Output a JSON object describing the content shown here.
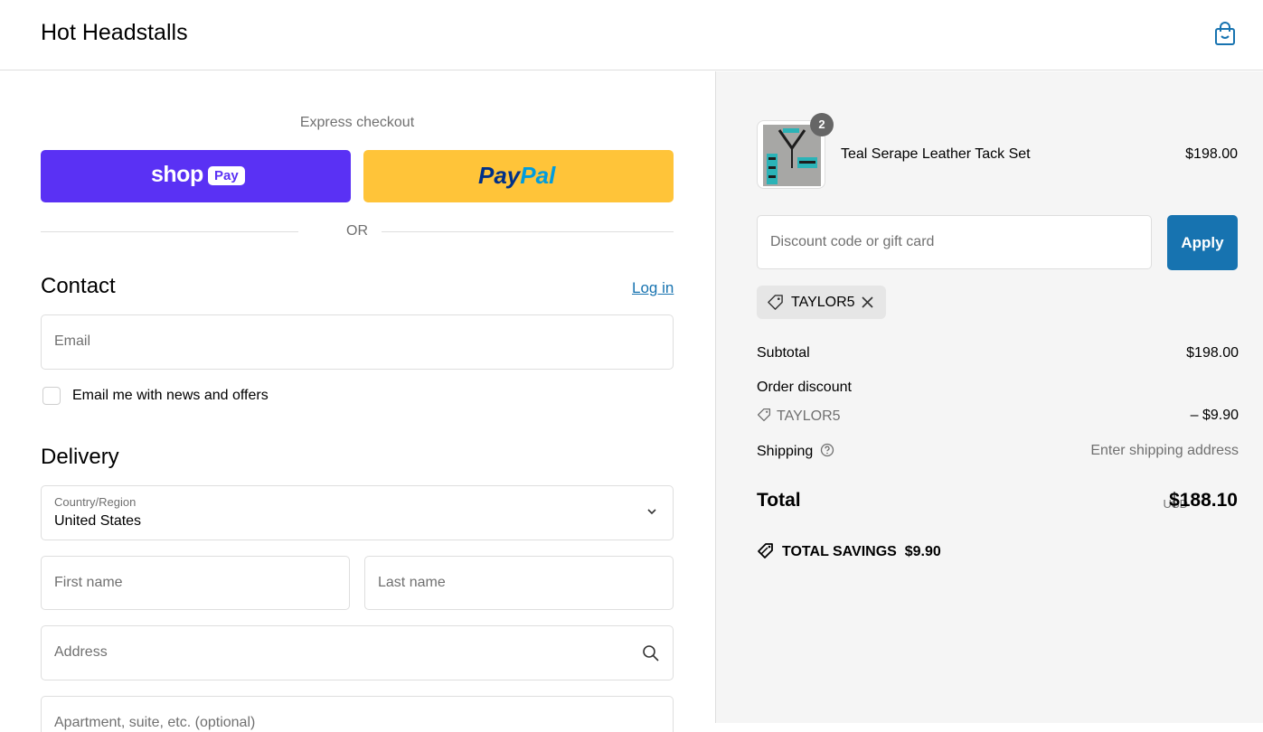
{
  "header": {
    "store_name": "Hot Headstalls",
    "cart_icon": "shopping-bag-icon"
  },
  "express": {
    "title": "Express checkout",
    "shop_pay_word": "shop",
    "shop_pay_badge": "Pay",
    "paypal_a": "Pay",
    "paypal_b": "Pal",
    "or_text": "OR"
  },
  "contact": {
    "heading": "Contact",
    "login_link": "Log in",
    "email_placeholder": "Email",
    "newsletter_label": "Email me with news and offers",
    "newsletter_checked": false
  },
  "delivery": {
    "heading": "Delivery",
    "country_label": "Country/Region",
    "country_value": "United States",
    "first_name_placeholder": "First name",
    "last_name_placeholder": "Last name",
    "address_placeholder": "Address",
    "apartment_placeholder": "Apartment, suite, etc. (optional)"
  },
  "order": {
    "item": {
      "name": "Teal Serape Leather Tack Set",
      "price": "$198.00",
      "quantity": "2"
    },
    "discount_placeholder": "Discount code or gift card",
    "apply_label": "Apply",
    "applied_code": "TAYLOR5",
    "subtotal_label": "Subtotal",
    "subtotal_value": "$198.00",
    "order_discount_label": "Order discount",
    "discount_code": "TAYLOR5",
    "discount_value": "– $9.90",
    "shipping_label": "Shipping",
    "shipping_value": "Enter shipping address",
    "total_label": "Total",
    "total_currency": "USD",
    "total_value": "$188.10",
    "savings_label": "TOTAL SAVINGS",
    "savings_value": "$9.90"
  },
  "colors": {
    "shop_pay": "#5a31f4",
    "paypal": "#ffc439",
    "link": "#1773b0",
    "apply": "#1773b0"
  }
}
